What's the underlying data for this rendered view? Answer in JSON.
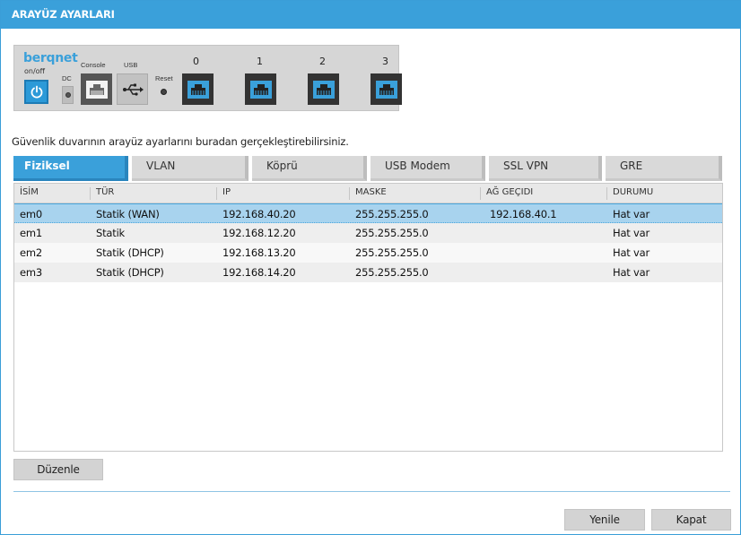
{
  "window": {
    "title": "ARAYÜZ AYARLARI"
  },
  "device": {
    "brand": "berqnet",
    "power_label": "on/off",
    "dc_label": "DC",
    "console_label": "Console",
    "usb_label": "USB",
    "reset_label": "Reset",
    "ports": [
      "0",
      "1",
      "2",
      "3"
    ]
  },
  "description": "Güvenlik duvarının arayüz ayarlarını buradan gerçekleştirebilirsiniz.",
  "tabs": [
    {
      "label": "Fiziksel",
      "active": true
    },
    {
      "label": "VLAN",
      "active": false
    },
    {
      "label": "Köprü",
      "active": false
    },
    {
      "label": "USB Modem",
      "active": false
    },
    {
      "label": "SSL VPN",
      "active": false
    },
    {
      "label": "GRE",
      "active": false
    }
  ],
  "table": {
    "columns": [
      "İSİM",
      "TÜR",
      "IP",
      "MASKE",
      "AĞ GEÇIDI",
      "DURUMU"
    ],
    "rows": [
      {
        "name": "em0",
        "type": "Statik (WAN)",
        "ip": "192.168.40.20",
        "mask": "255.255.255.0",
        "gateway": "192.168.40.1",
        "status": "Hat var",
        "selected": true
      },
      {
        "name": "em1",
        "type": "Statik",
        "ip": "192.168.12.20",
        "mask": "255.255.255.0",
        "gateway": "",
        "status": "Hat var",
        "selected": false
      },
      {
        "name": "em2",
        "type": "Statik (DHCP)",
        "ip": "192.168.13.20",
        "mask": "255.255.255.0",
        "gateway": "",
        "status": "Hat var",
        "selected": false
      },
      {
        "name": "em3",
        "type": "Statik (DHCP)",
        "ip": "192.168.14.20",
        "mask": "255.255.255.0",
        "gateway": "",
        "status": "Hat var",
        "selected": false
      }
    ]
  },
  "buttons": {
    "edit": "Düzenle",
    "refresh": "Yenile",
    "close": "Kapat"
  },
  "colors": {
    "accent": "#3aa0da",
    "selected_row": "#a8d3ee"
  }
}
